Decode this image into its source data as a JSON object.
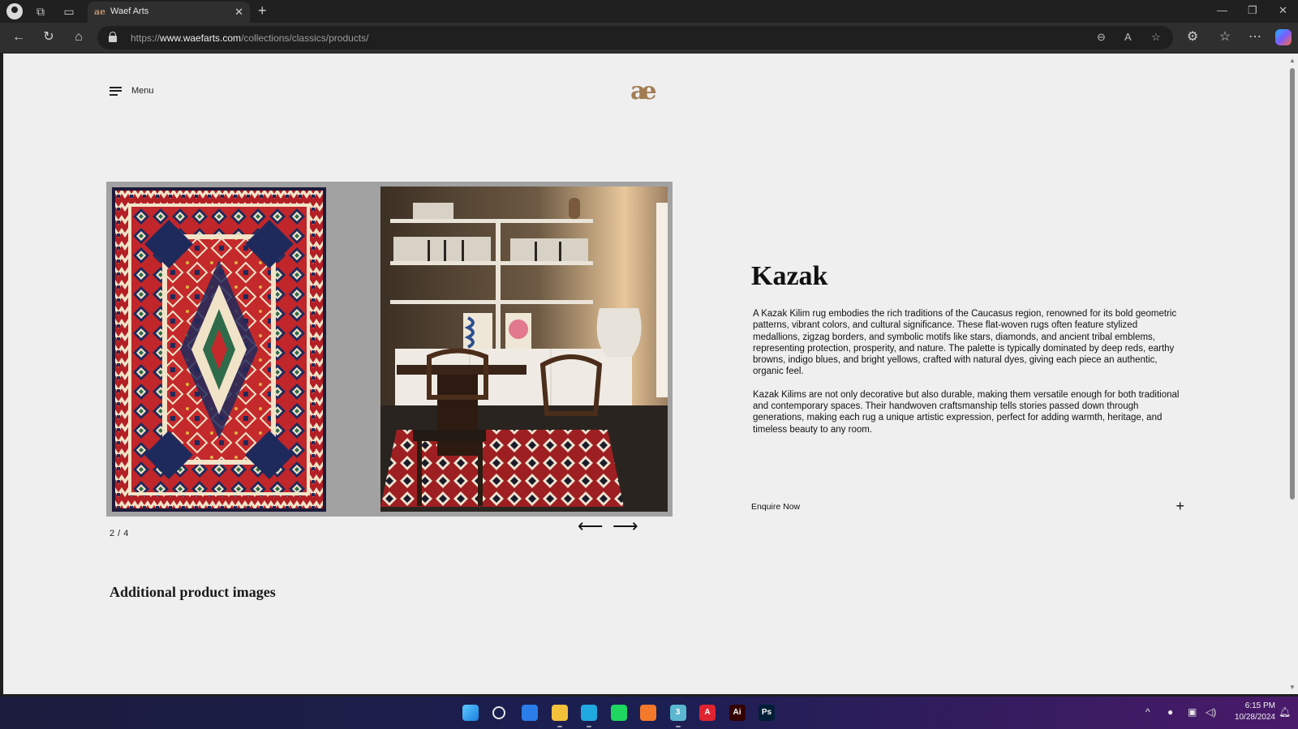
{
  "browser": {
    "tab_title": "Waef Arts",
    "favicon_glyph": "ae",
    "url_prefix": "https://",
    "url_domain": "www.waefarts.com",
    "url_path": "/collections/classics/products/",
    "icons": {
      "profile": "profile-icon",
      "workspaces": "workspaces-icon",
      "tab_actions": "tab-actions-icon",
      "new_tab": "plus-icon",
      "back": "back-arrow-icon",
      "refresh": "refresh-icon",
      "home": "home-icon",
      "lock": "lock-icon",
      "zoom": "zoom-out-icon",
      "read_aloud": "read-aloud-icon",
      "favorite": "star-icon",
      "extensions": "extensions-icon",
      "favorites": "favorites-icon",
      "more": "more-icon",
      "copilot": "copilot-icon"
    }
  },
  "header": {
    "menu_label": "Menu",
    "logo_glyph": "ae",
    "brand_color": "#a37d52"
  },
  "gallery": {
    "counter": "2 / 4",
    "prev_glyph": "⟵",
    "next_glyph": "⟶"
  },
  "product": {
    "title": "Kazak",
    "paragraphs": [
      "A Kazak Kilim rug embodies the rich traditions of the Caucasus region, renowned for its bold geometric patterns, vibrant colors, and cultural significance. These flat-woven rugs often feature stylized medallions, zigzag borders, and symbolic motifs like stars, diamonds, and ancient tribal emblems, representing protection, prosperity, and nature. The palette is typically dominated by deep reds, earthy browns, indigo blues, and bright yellows, crafted with natural dyes, giving each piece an authentic, organic feel.",
      "Kazak Kilims are not only decorative but also durable, making them versatile enough for both traditional and contemporary spaces. Their handwoven craftsmanship tells stories passed down through generations, making each rug a unique artistic expression, perfect for adding warmth, heritage, and timeless beauty to any room."
    ],
    "enquire_label": "Enquire Now",
    "enquire_glyph": "+"
  },
  "additional": {
    "heading": "Additional product images"
  },
  "taskbar": {
    "apps": [
      {
        "name": "start-icon",
        "color": "#3aa0ff",
        "label": ""
      },
      {
        "name": "search-icon",
        "color": "transparent",
        "label": ""
      },
      {
        "name": "mail-icon",
        "color": "#2b7de9",
        "label": ""
      },
      {
        "name": "file-explorer-icon",
        "color": "#f3c13a",
        "label": ""
      },
      {
        "name": "edge-icon",
        "color": "#1fa9e0",
        "label": ""
      },
      {
        "name": "spotify-icon",
        "color": "#1ed760",
        "label": ""
      },
      {
        "name": "blender-icon",
        "color": "#f5792a",
        "label": ""
      },
      {
        "name": "app-3-icon",
        "color": "#5bb6d0",
        "label": "3"
      },
      {
        "name": "acrobat-icon",
        "color": "#e0242f",
        "label": "A"
      },
      {
        "name": "illustrator-icon",
        "color": "#330000",
        "label": "Ai"
      },
      {
        "name": "photoshop-icon",
        "color": "#001e36",
        "label": "Ps"
      }
    ],
    "time": "6:15 PM",
    "date": "10/28/2024"
  }
}
